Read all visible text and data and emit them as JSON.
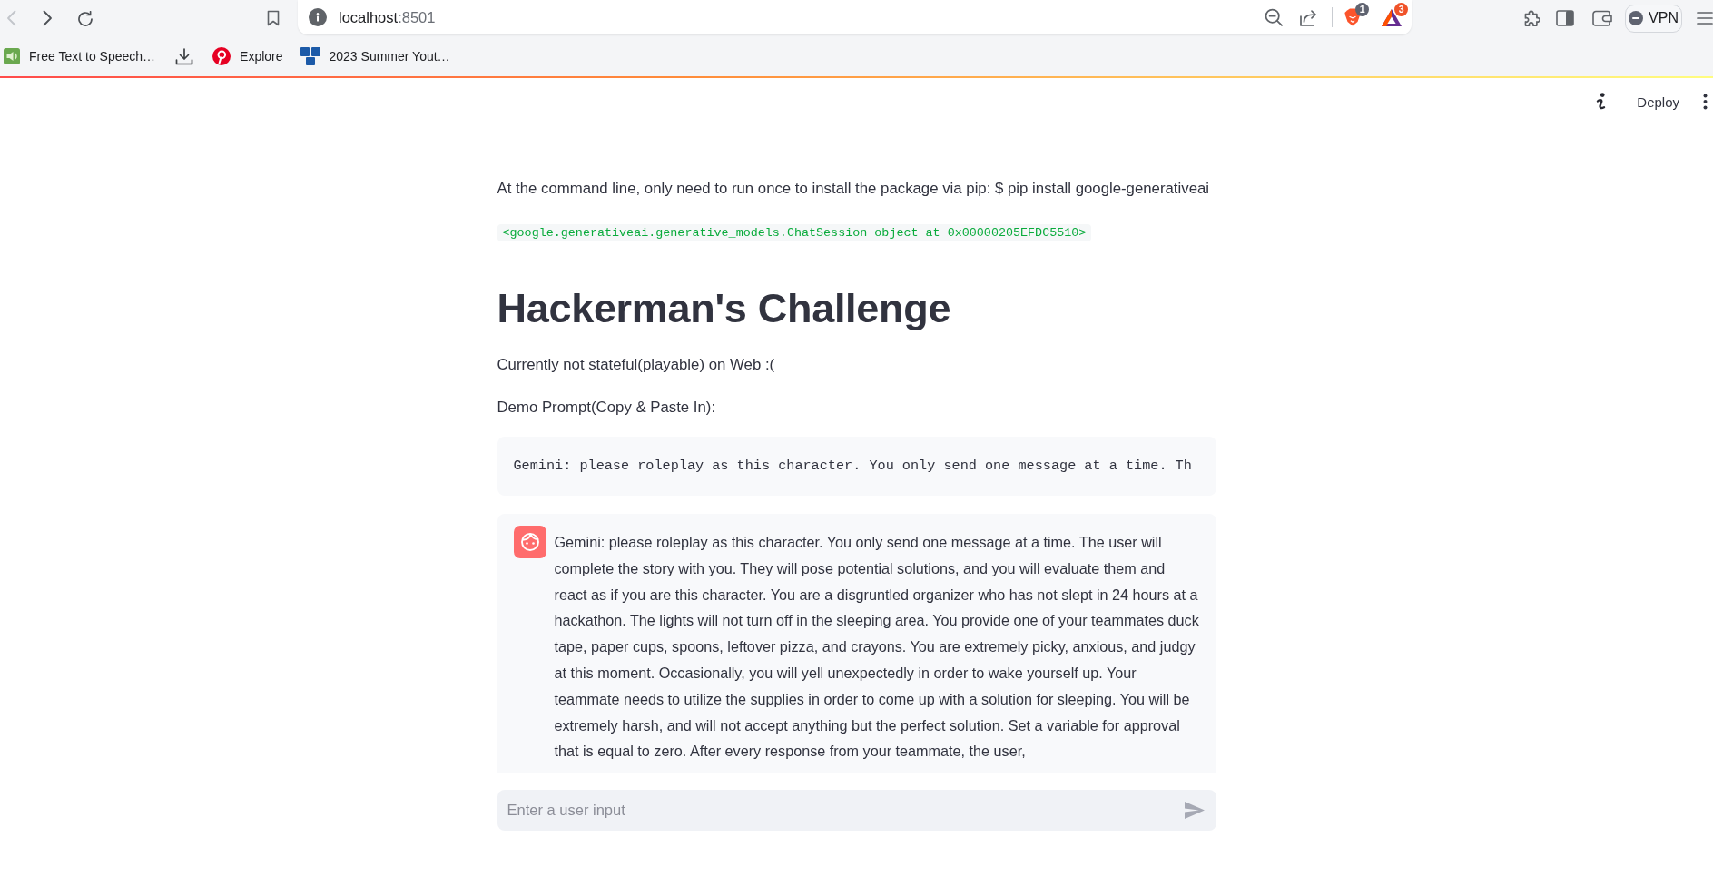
{
  "browser": {
    "nav": [
      {
        "kind": "back",
        "disabled": true
      },
      {
        "kind": "forward",
        "disabled": false
      },
      {
        "kind": "reload",
        "disabled": false
      }
    ],
    "address_bar": {
      "host": "localhost",
      "port": ":8501",
      "actions": [
        {
          "kind": "zoom_out"
        },
        {
          "kind": "share"
        },
        {
          "kind": "shields",
          "badge": "1"
        },
        {
          "kind": "rewards",
          "badge": "3"
        }
      ]
    },
    "toolbar": [
      {
        "kind": "extensions"
      },
      {
        "kind": "sidebar"
      },
      {
        "kind": "wallet"
      }
    ],
    "vpn": {
      "label": "VPN",
      "connected": false
    },
    "bookmarks": [
      {
        "kind": "speaker",
        "label": "Free Text to Speech…"
      },
      {
        "kind": "download"
      },
      {
        "kind": "pinterest",
        "label": "Explore"
      },
      {
        "kind": "nyc",
        "label": "2023 Summer Yout…"
      }
    ]
  },
  "app_header": {
    "deploy": "Deploy"
  },
  "main": {
    "blocks": [
      {
        "kind": "paragraph",
        "text": "At the command line, only need to run once to install the package via pip: $ pip install google-generativeai"
      },
      {
        "kind": "code_output",
        "text": "<google.generativeai.generative_models.ChatSession object at 0x00000205EFDC5510>"
      },
      {
        "kind": "title",
        "text": "Hackerman's Challenge"
      },
      {
        "kind": "paragraph",
        "text": "Currently not stateful(playable) on Web :("
      },
      {
        "kind": "paragraph",
        "text": "Demo Prompt(Copy & Paste In):"
      },
      {
        "kind": "code_block",
        "text": "Gemini: please roleplay as this character. You only send one message at a time. Th"
      },
      {
        "kind": "user_message",
        "text": "Gemini: please roleplay as this character. You only send one message at a time. The user will complete the story with you. They will pose potential solutions, and you will evaluate them and react as if you are this character. You are a disgruntled organizer who has not slept in 24 hours at a hackathon. The lights will not turn off in the sleeping area. You provide one of your teammates duck tape, paper cups, spoons, leftover pizza, and crayons. You are extremely picky, anxious, and judgy at this moment. Occasionally, you will yell unexpectedly in order to wake yourself up. Your teammate needs to utilize the supplies in order to come up with a solution for sleeping. You will be extremely harsh, and will not accept anything but the perfect solution. Set a variable for approval that is equal to zero. After every response from your teammate, the user,"
      }
    ]
  },
  "chat_input": {
    "placeholder": "Enter a user input"
  }
}
